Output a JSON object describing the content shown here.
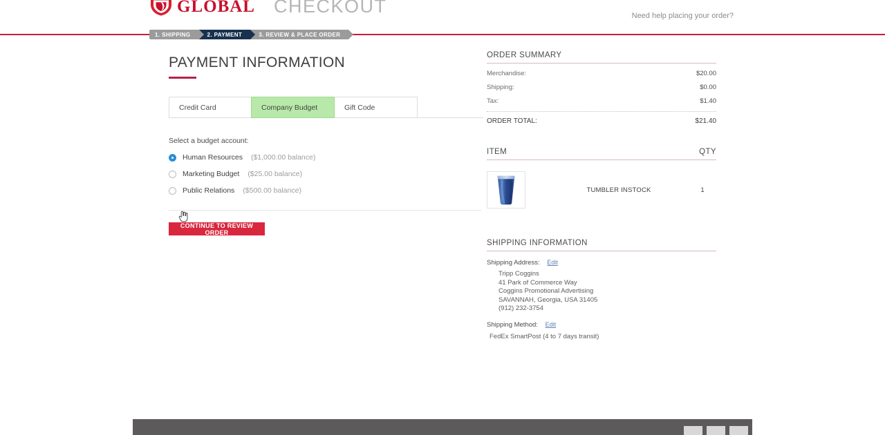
{
  "header": {
    "logo_text": "GLOBAL",
    "logo_icon": "shield-swoosh-logo-icon",
    "page_word": "CHECKOUT",
    "help_text": "Need help placing your order?"
  },
  "steps": [
    {
      "label": "1. SHIPPING",
      "active": false
    },
    {
      "label": "2. PAYMENT",
      "active": true
    },
    {
      "label": "3. REVIEW & PLACE ORDER",
      "active": false
    }
  ],
  "payment": {
    "title": "PAYMENT INFORMATION",
    "tabs": [
      {
        "label": "Credit Card",
        "selected": false
      },
      {
        "label": "Company Budget",
        "selected": true
      },
      {
        "label": "Gift Code",
        "selected": false
      }
    ],
    "budget_prompt": "Select a budget account:",
    "accounts": [
      {
        "name": "Human Resources",
        "balance": "($1,000.00 balance)",
        "checked": true
      },
      {
        "name": "Marketing Budget",
        "balance": "($25.00 balance)",
        "checked": false
      },
      {
        "name": "Public Relations",
        "balance": "($500.00 balance)",
        "checked": false
      }
    ],
    "continue_label": "CONTINUE TO REVIEW ORDER"
  },
  "order_summary": {
    "heading": "ORDER SUMMARY",
    "rows": [
      {
        "label": "Merchandise:",
        "amount": "$20.00"
      },
      {
        "label": "Shipping:",
        "amount": "$0.00"
      },
      {
        "label": "Tax:",
        "amount": "$1.40"
      }
    ],
    "total_label": "ORDER TOTAL:",
    "total_amount": "$21.40"
  },
  "item_table": {
    "col_item": "ITEM",
    "col_qty": "QTY",
    "rows": [
      {
        "name": "TUMBLER INSTOCK",
        "qty": "1",
        "thumb_icon": "blue-tumbler-product-image"
      }
    ]
  },
  "shipping": {
    "heading": "SHIPPING INFORMATION",
    "address_label": "Shipping Address:",
    "address_edit": "Edit",
    "address_lines": [
      "Tripp Coggins",
      "41 Park of Commerce Way",
      "Coggins Promotional Advertising",
      "SAVANNAH, Georgia, USA 31405",
      "(912) 232-3754"
    ],
    "method_label": "Shipping Method:",
    "method_edit": "Edit",
    "method_value": "FedEx SmartPost (4 to 7 days transit)"
  },
  "colors": {
    "brand_red": "#c8102e",
    "rule_red": "#c8193c",
    "button_red": "#d9273e",
    "active_step": "#17314f",
    "inactive_step": "#9b9b9b",
    "selected_tab_green": "#b9e8ab",
    "radio_blue": "#2a8fd4",
    "footer_gray": "#5d5a5c"
  }
}
